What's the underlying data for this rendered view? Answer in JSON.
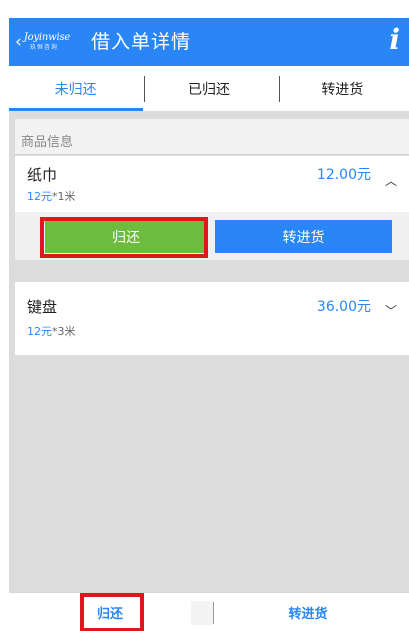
{
  "header": {
    "back_icon": "chevron-left-icon",
    "logo_text": "Joyinwise",
    "logo_sub": "玖恒咨询",
    "title": "借入单详情",
    "info_label": "i",
    "accent": "#2a86f7"
  },
  "tabs": [
    {
      "label": "未归还",
      "active": true
    },
    {
      "label": "已归还",
      "active": false
    },
    {
      "label": "转进货",
      "active": false
    }
  ],
  "section": {
    "label": "商品信息"
  },
  "items": [
    {
      "name": "纸巾",
      "unit_price": "12元",
      "qty": "*1米",
      "amount": "12.00元",
      "expanded": true
    },
    {
      "name": "键盘",
      "unit_price": "12元",
      "qty": "*3米",
      "amount": "36.00元",
      "expanded": false
    }
  ],
  "actions": {
    "return_label": "归还",
    "transfer_label": "转进货",
    "return_color": "#6dbb3f",
    "transfer_color": "#2a86f7",
    "highlight_color": "#e0151d"
  },
  "bottom": {
    "return_label": "归还",
    "transfer_label": "转进货"
  }
}
